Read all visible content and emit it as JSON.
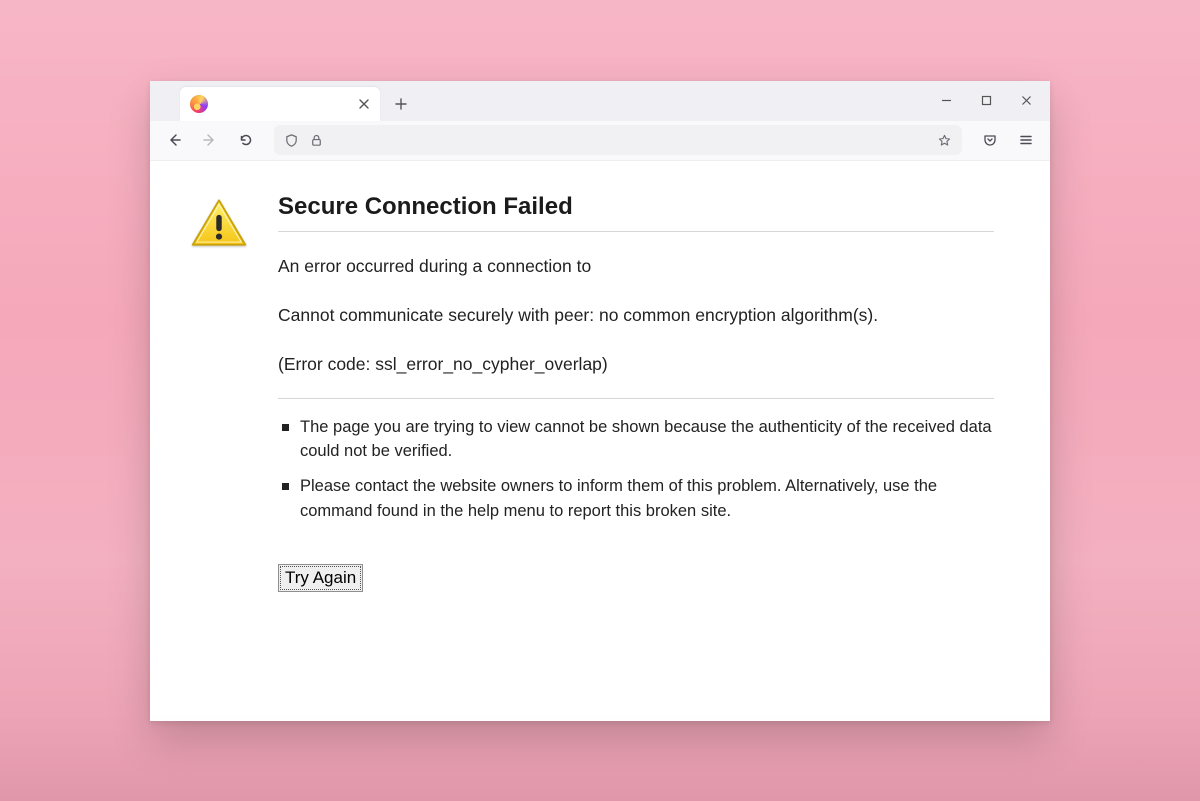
{
  "window": {
    "tab_title": "",
    "minimize": "Minimize",
    "maximize": "Maximize",
    "close": "Close"
  },
  "error": {
    "heading": "Secure Connection Failed",
    "line1": "An error occurred during a connection to",
    "line2": "Cannot communicate securely with peer: no common encryption algorithm(s).",
    "line3": "(Error code: ssl_error_no_cypher_overlap)",
    "bullets": [
      "The page you are trying to view cannot be shown because the authenticity of the received data could not be verified.",
      "Please contact the website owners to inform them of this problem. Alternatively, use the command found in the help menu to report this broken site."
    ],
    "try_again": "Try Again"
  }
}
